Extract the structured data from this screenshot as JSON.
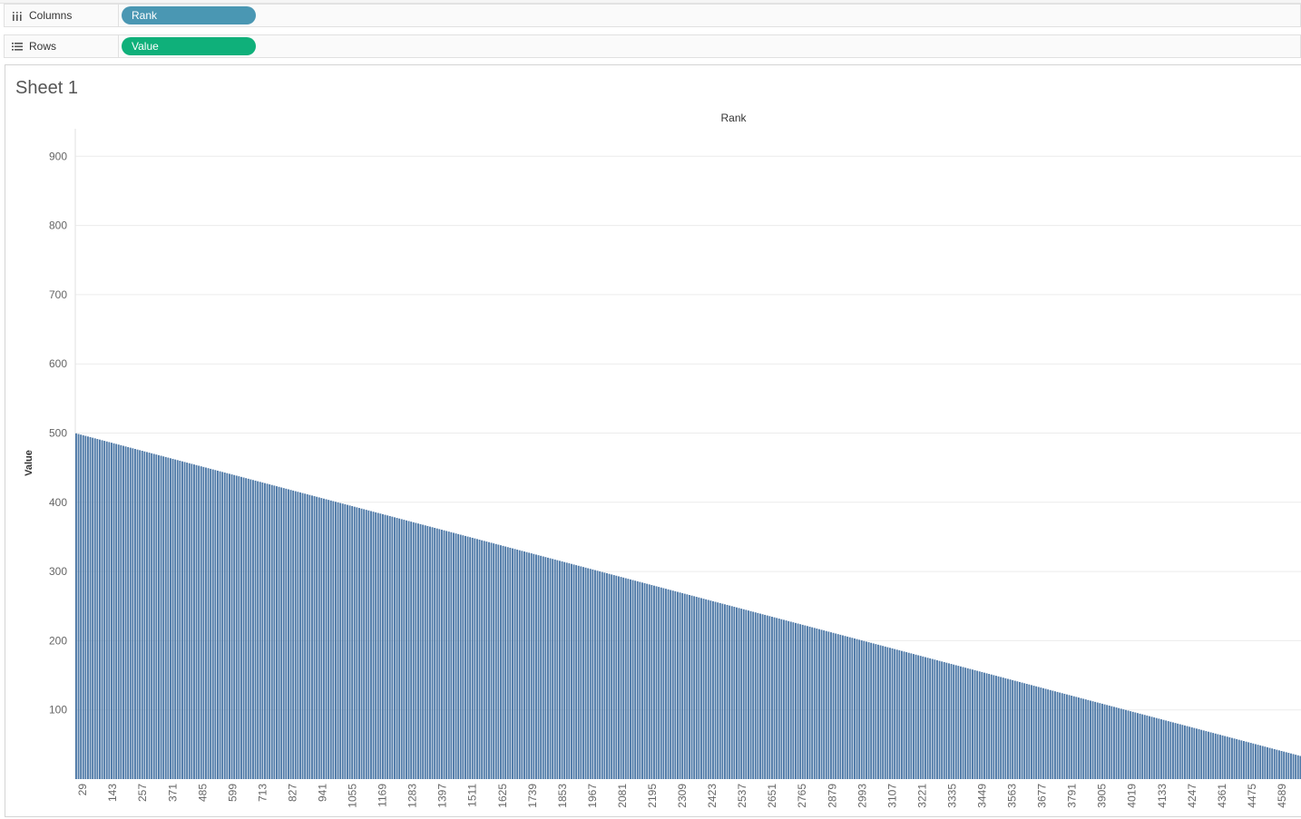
{
  "shelves": {
    "columns": {
      "label": "Columns",
      "pill": "Rank",
      "pill_color": "#4a97b3"
    },
    "rows": {
      "label": "Rows",
      "pill": "Value",
      "pill_color": "#0fb07a"
    }
  },
  "sheet": {
    "title": "Sheet 1"
  },
  "chart_data": {
    "type": "bar",
    "xlabel": "Rank",
    "ylabel": "Value",
    "ylim": [
      0,
      950
    ],
    "yticks": [
      100,
      200,
      300,
      400,
      500,
      600,
      700,
      800,
      900
    ],
    "xticks": [
      "29",
      "143",
      "257",
      "371",
      "485",
      "599",
      "713",
      "827",
      "941",
      "1055",
      "1169",
      "1283",
      "1397",
      "1511",
      "1625",
      "1739",
      "1853",
      "1967",
      "2081",
      "2195",
      "2309",
      "2423",
      "2537",
      "2651",
      "2765",
      "2879",
      "2993",
      "3107",
      "3221",
      "3335",
      "3449",
      "3563",
      "3677",
      "3791",
      "3905",
      "4019",
      "4133",
      "4247",
      "4361",
      "4475",
      "4589"
    ],
    "x_range": [
      1,
      4665
    ],
    "series": [
      {
        "points": [
          [
            1,
            500
          ],
          [
            4665,
            33
          ]
        ],
        "interpolation": "linear"
      }
    ],
    "bar_color": "#4e79a7",
    "grid": true
  }
}
